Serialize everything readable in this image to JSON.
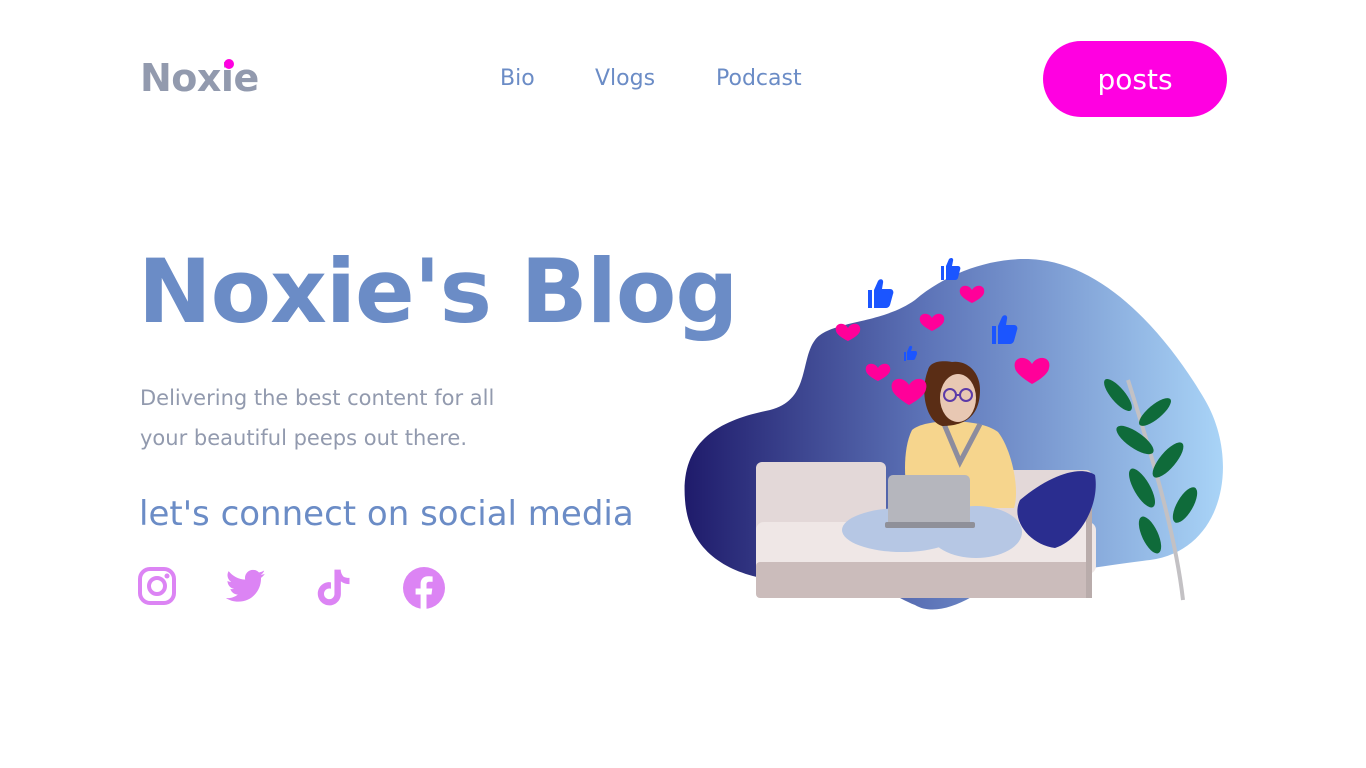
{
  "header": {
    "logo_text": "Noxie",
    "nav": [
      {
        "label": "Bio"
      },
      {
        "label": "Vlogs"
      },
      {
        "label": "Podcast"
      }
    ],
    "cta_label": "posts"
  },
  "hero": {
    "title": "Noxie's Blog",
    "subtitle_line1": "Delivering the best content for all",
    "subtitle_line2": "your beautiful peeps out there.",
    "connect_text": "let's connect on social media"
  },
  "social": [
    {
      "icon": "instagram-icon"
    },
    {
      "icon": "twitter-icon"
    },
    {
      "icon": "tiktok-icon"
    },
    {
      "icon": "facebook-icon"
    }
  ],
  "colors": {
    "accent": "#ff00e1",
    "primary_text": "#6b8cc6",
    "muted_text": "#929aae",
    "social_icons": "#dc84f4",
    "blob_start": "#1f1b6b",
    "blob_end": "#a9d4f7"
  }
}
